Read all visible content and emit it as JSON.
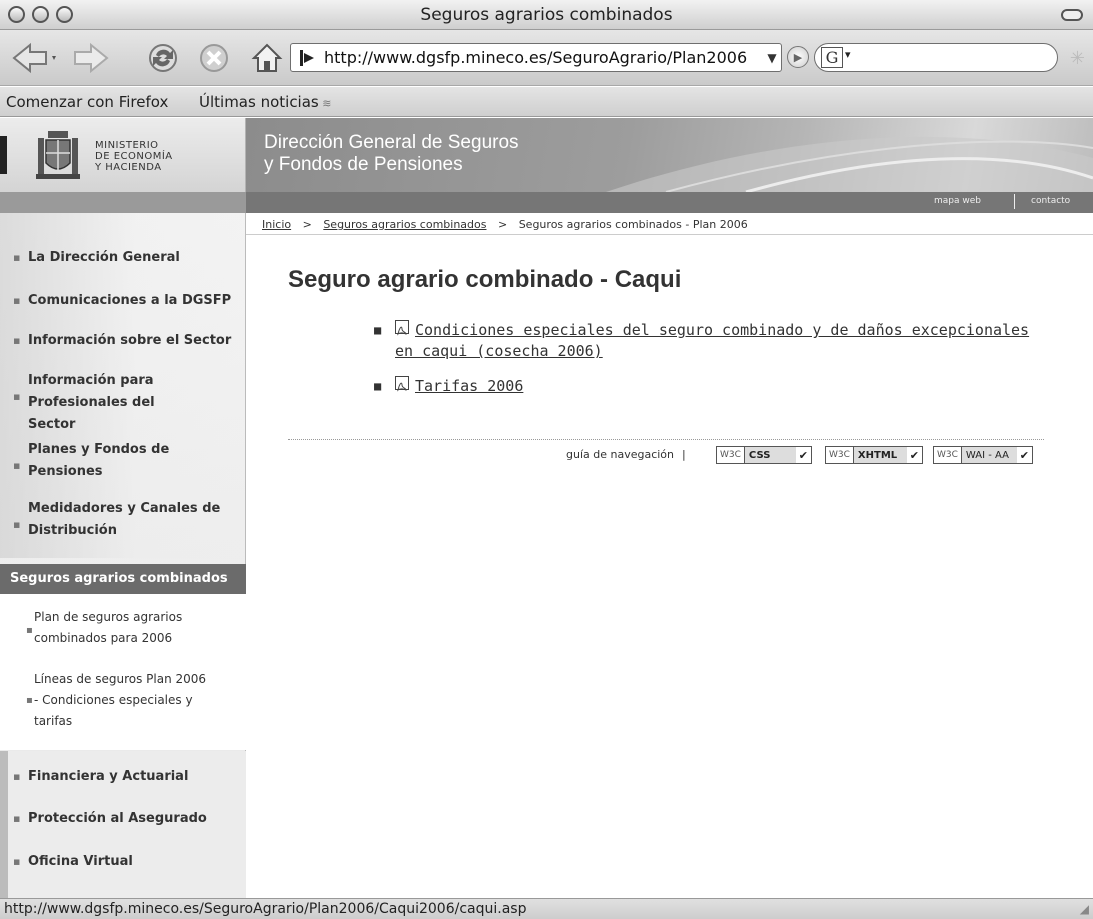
{
  "window": {
    "title": "Seguros agrarios combinados"
  },
  "toolbar": {
    "url": "http://www.dgsfp.mineco.es/SeguroAgrario/Plan2006",
    "search_placeholder": ""
  },
  "bookmarks": [
    {
      "label": "Comenzar con Firefox"
    },
    {
      "label": "Últimas noticias"
    }
  ],
  "header": {
    "ministry": [
      "MINISTERIO",
      "DE ECONOMÍA",
      "Y HACIENDA"
    ],
    "title_line1": "Dirección General de Seguros",
    "title_line2": "y Fondos de Pensiones",
    "links": [
      "mapa web",
      "contacto"
    ]
  },
  "breadcrumb": {
    "items": [
      "Inicio",
      "Seguros agrarios combinados",
      "Seguros agrarios combinados - Plan 2006"
    ],
    "separator": ">"
  },
  "sidebar": {
    "items": [
      {
        "label": "La Dirección General"
      },
      {
        "label": "Comunicaciones a la DGSFP"
      },
      {
        "label": "Información sobre el Sector"
      },
      {
        "label": "Información para Profesionales del Sector"
      },
      {
        "label": "Planes y Fondos de Pensiones"
      },
      {
        "label": "Medidadores y Canales de Distribución"
      }
    ],
    "active": "Seguros agrarios combinados",
    "subitems": [
      {
        "label": "Plan de seguros agrarios combinados para 2006"
      },
      {
        "label": "Líneas de seguros Plan 2006 - Condiciones especiales y tarifas"
      }
    ],
    "lower_items": [
      {
        "label": "Financiera y Actuarial"
      },
      {
        "label": "Protección al Asegurado"
      },
      {
        "label": "Oficina Virtual"
      }
    ]
  },
  "main": {
    "title": "Seguro agrario combinado - Caqui",
    "documents": [
      {
        "label": "Condiciones especiales del seguro combinado y de daños excepcionales en caqui (cosecha 2006)",
        "icon": "pdf-icon"
      },
      {
        "label": "Tarifas 2006",
        "icon": "pdf-icon"
      }
    ],
    "footer": {
      "nav_link": "guía de navegación",
      "separator": "|",
      "badges": [
        {
          "logo": "W3C",
          "label": "CSS"
        },
        {
          "logo": "W3C",
          "label": "XHTML"
        },
        {
          "logo": "W3C",
          "label": "WAI - AA"
        }
      ]
    }
  },
  "status": {
    "text": "http://www.dgsfp.mineco.es/SeguroAgrario/Plan2006/Caqui2006/caqui.asp"
  },
  "icons": {
    "back": "back-arrow-icon",
    "forward": "forward-arrow-icon",
    "reload": "reload-icon",
    "stop": "stop-icon",
    "home": "home-icon",
    "go": "go-icon",
    "search_engine": "google-icon",
    "rss": "rss-icon",
    "pdf": "pdf-icon"
  }
}
